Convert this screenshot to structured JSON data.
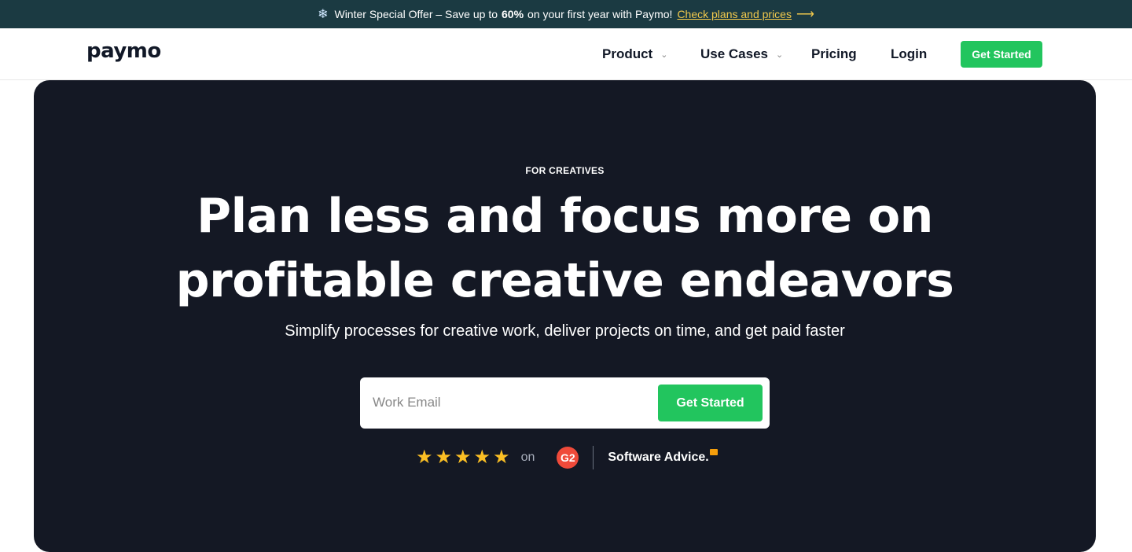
{
  "promo": {
    "text_before": "Winter Special Offer – Save up to",
    "highlight": "60%",
    "text_after": "on your first year with Paymo!",
    "link": "Check plans and prices"
  },
  "header": {
    "logo": "paymo",
    "nav": [
      "Product",
      "Use Cases",
      "Pricing",
      "Login"
    ],
    "cta": "Get Started"
  },
  "hero": {
    "eyebrow": "FOR CREATIVES",
    "headline_line1": "Plan less and focus more on",
    "headline_line2": "profitable creative endeavors",
    "subhead": "Simplify processes for creative work, deliver projects on time, and get paid faster",
    "email_placeholder": "Work Email",
    "cta": "Get Started",
    "rating_stars": 5,
    "rating_on": "on",
    "g2_badge": "G2",
    "software_advice": "Software Advice."
  },
  "colors": {
    "promo_bg": "#1b3a42",
    "accent_green": "#22c55e",
    "hero_bg": "#141824",
    "link_yellow": "#f2c94c",
    "star": "#fbbf24",
    "g2_red": "#ef4a3a"
  },
  "icons": {
    "promo": "snowflake-icon",
    "promo_link_arrow": "arrow-right-icon",
    "nav_dropdown": "chevron-down-icon",
    "rating": "star-icon"
  }
}
